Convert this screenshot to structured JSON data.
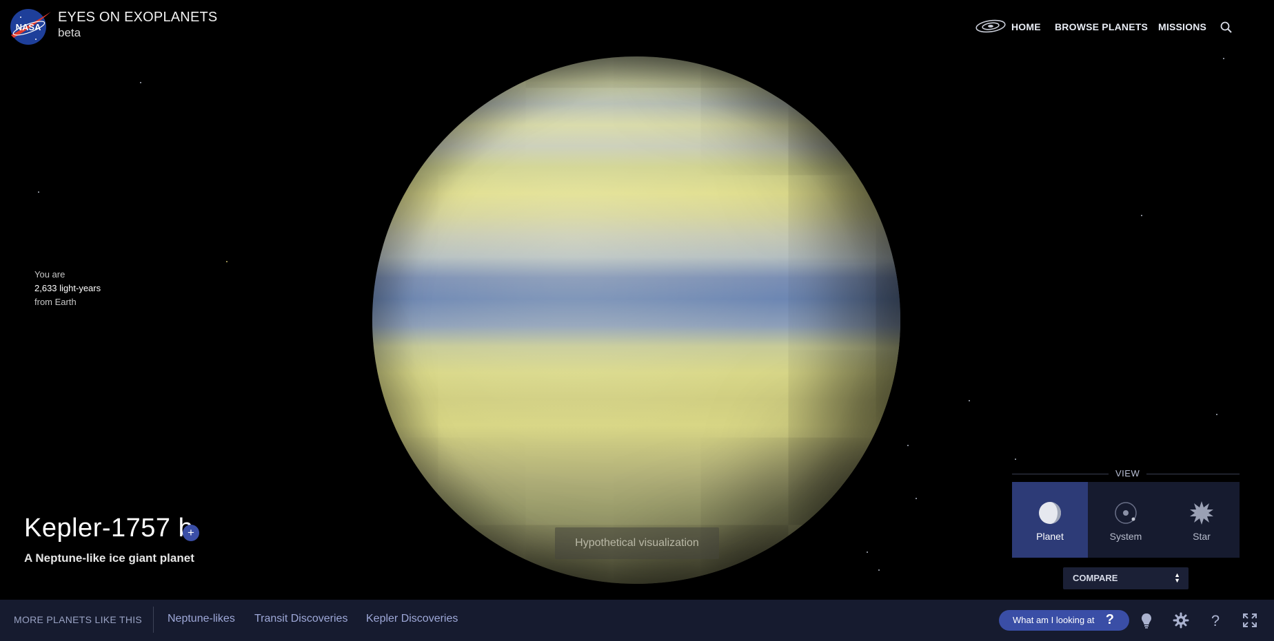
{
  "header": {
    "logo_icon": "nasa-meatball-logo",
    "logo_text": "NASA",
    "title": "EYES ON EXOPLANETS",
    "subtitle": "beta"
  },
  "nav": {
    "galaxy_icon": "galaxy-icon",
    "items": [
      {
        "label": "HOME"
      },
      {
        "label": "BROWSE PLANETS"
      },
      {
        "label": "MISSIONS"
      }
    ],
    "search_icon": "search-icon"
  },
  "distance": {
    "prefix": "You are",
    "value": "2,633 light-years",
    "suffix": "from Earth"
  },
  "planet": {
    "name": "Kepler-1757 b",
    "add_label": "+",
    "description": "A Neptune-like ice giant planet",
    "visualization_note": "Hypothetical visualization"
  },
  "view": {
    "label": "VIEW",
    "options": [
      {
        "label": "Planet",
        "icon": "planet-icon",
        "active": true
      },
      {
        "label": "System",
        "icon": "system-icon",
        "active": false
      },
      {
        "label": "Star",
        "icon": "star-icon",
        "active": false
      }
    ],
    "compare_label": "COMPARE"
  },
  "bottom_bar": {
    "more_label": "MORE PLANETS LIKE THIS",
    "links": [
      {
        "label": "Neptune-likes"
      },
      {
        "label": "Transit Discoveries"
      },
      {
        "label": "Kepler Discoveries"
      }
    ],
    "what_label": "What am I looking at",
    "what_icon": "question-icon",
    "icons": [
      "lightbulb-icon",
      "settings-gear-icon",
      "help-icon",
      "fullscreen-icon"
    ]
  },
  "colors": {
    "accent": "#3a4ea6",
    "bar_bg": "#161b2f",
    "active_view": "#2d3b77",
    "link": "#9ea8d8"
  }
}
